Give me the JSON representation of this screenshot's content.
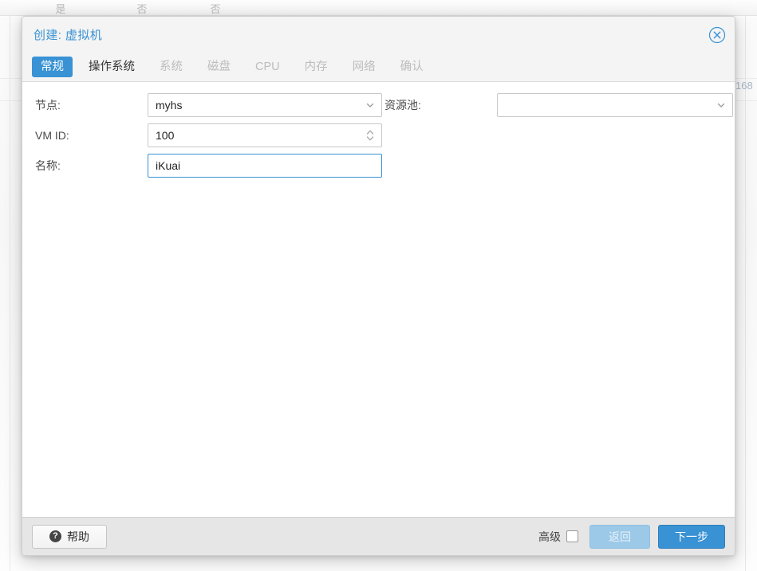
{
  "background": {
    "table_cells": [
      "是",
      "否",
      "否"
    ],
    "right_edge_text": "168"
  },
  "dialog": {
    "title": "创建: 虚拟机",
    "close_icon": "close-circle-icon",
    "tabs": [
      {
        "label": "常规",
        "state": "active"
      },
      {
        "label": "操作系统",
        "state": "enabled"
      },
      {
        "label": "系统",
        "state": "disabled"
      },
      {
        "label": "磁盘",
        "state": "disabled"
      },
      {
        "label": "CPU",
        "state": "disabled"
      },
      {
        "label": "内存",
        "state": "disabled"
      },
      {
        "label": "网络",
        "state": "disabled"
      },
      {
        "label": "确认",
        "state": "disabled"
      }
    ],
    "form": {
      "node": {
        "label": "节点:",
        "value": "myhs",
        "icon": "chevron-down-icon"
      },
      "vmid": {
        "label": "VM ID:",
        "value": "100",
        "icon": "spinner-updown-icon"
      },
      "name": {
        "label": "名称:",
        "value": "iKuai",
        "placeholder": ""
      },
      "resource_pool": {
        "label": "资源池:",
        "value": "",
        "placeholder": "",
        "icon": "chevron-down-icon"
      }
    },
    "footer": {
      "help_label": "帮助",
      "help_icon": "question-mark-icon",
      "advanced_label": "高级",
      "advanced_checked": false,
      "back_label": "返回",
      "back_disabled": true,
      "next_label": "下一步"
    }
  },
  "colors": {
    "accent": "#3892d4",
    "header_bg": "#f4f4f4",
    "footer_bg": "#e6e6e6",
    "disabled_tab": "#bdbdbd",
    "back_disabled": "#9cc9e8"
  }
}
